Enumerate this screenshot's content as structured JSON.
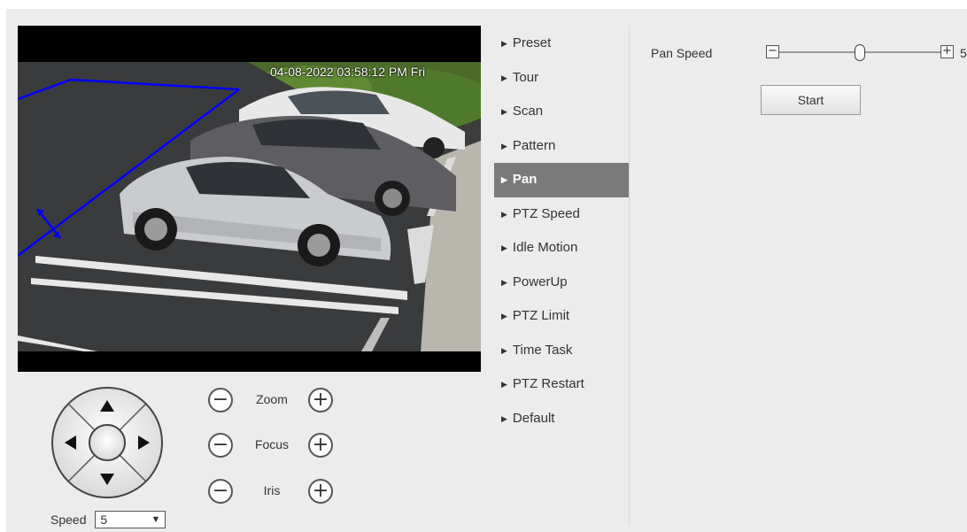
{
  "video": {
    "osd_timestamp": "04-08-2022 03:58:12 PM Fri"
  },
  "ptz": {
    "zoom_label": "Zoom",
    "focus_label": "Focus",
    "iris_label": "Iris",
    "minus_glyph": "−",
    "plus_glyph": "+",
    "speed_label": "Speed",
    "speed_value": "5"
  },
  "menu": {
    "items": [
      {
        "label": "Preset"
      },
      {
        "label": "Tour"
      },
      {
        "label": "Scan"
      },
      {
        "label": "Pattern"
      },
      {
        "label": "Pan",
        "active": true
      },
      {
        "label": "PTZ Speed"
      },
      {
        "label": "Idle Motion"
      },
      {
        "label": "PowerUp"
      },
      {
        "label": "PTZ Limit"
      },
      {
        "label": "Time Task"
      },
      {
        "label": "PTZ Restart"
      },
      {
        "label": "Default"
      }
    ]
  },
  "pan": {
    "speed_label": "Pan Speed",
    "speed_value": "5",
    "speed_level_fraction": 0.5,
    "start_label": "Start"
  },
  "colors": {
    "menu_active_bg": "#7a7a7a",
    "rule_line": "#0000ff",
    "panel_bg": "#ececec"
  },
  "icons": {
    "dpad": "direction-pad-icon",
    "up": "arrow-up-icon",
    "down": "arrow-down-icon",
    "left": "arrow-left-icon",
    "right": "arrow-right-icon",
    "menu_item": "triangle-right-icon",
    "select": "chevron-down-icon"
  }
}
